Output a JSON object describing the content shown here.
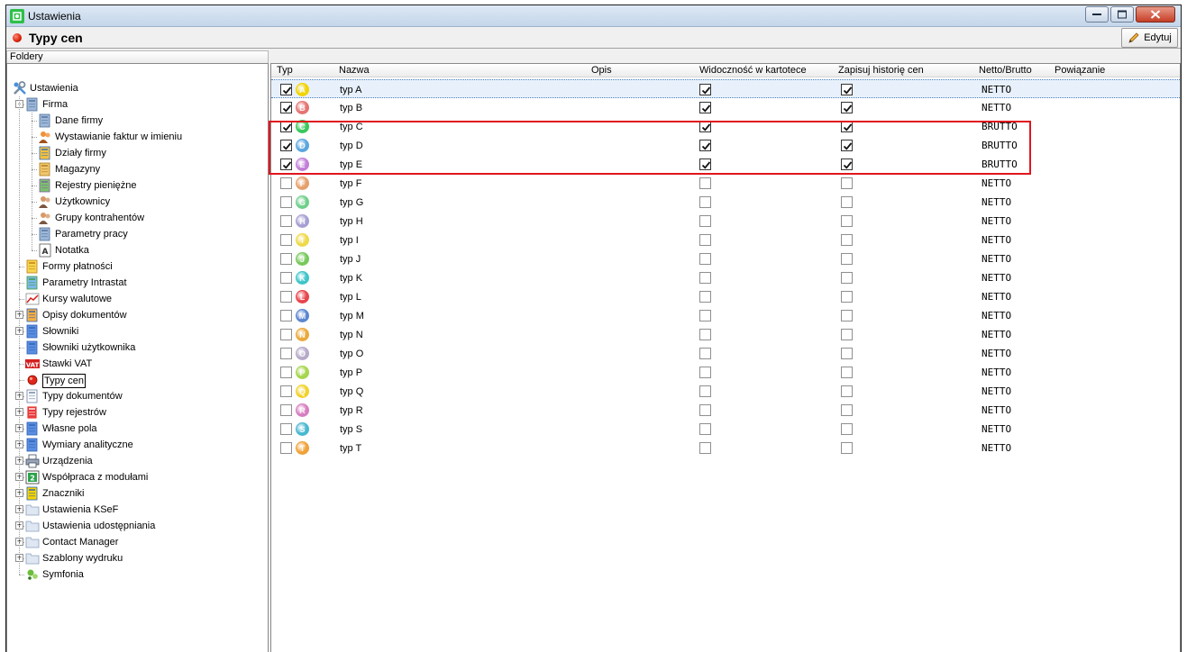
{
  "window": {
    "title": "Ustawienia"
  },
  "header": {
    "title": "Typy cen",
    "edit_label": "Edytuj"
  },
  "tree": {
    "header": "Foldery",
    "items": [
      {
        "label": "Ustawienia",
        "level": 0,
        "icon": "settings-tools-icon",
        "expander": null
      },
      {
        "label": "Firma",
        "level": 1,
        "icon": "company-icon",
        "expander": "-"
      },
      {
        "label": "Dane firmy",
        "level": 2,
        "icon": "company-data-icon",
        "expander": null
      },
      {
        "label": "Wystawianie faktur w imieniu",
        "level": 2,
        "icon": "person-icon",
        "expander": null
      },
      {
        "label": "Działy firmy",
        "level": 2,
        "icon": "departments-icon",
        "expander": null
      },
      {
        "label": "Magazyny",
        "level": 2,
        "icon": "warehouse-icon",
        "expander": null
      },
      {
        "label": "Rejestry pieniężne",
        "level": 2,
        "icon": "money-registers-icon",
        "expander": null
      },
      {
        "label": "Użytkownicy",
        "level": 2,
        "icon": "users-icon",
        "expander": null
      },
      {
        "label": "Grupy kontrahentów",
        "level": 2,
        "icon": "contractor-groups-icon",
        "expander": null
      },
      {
        "label": "Parametry pracy",
        "level": 2,
        "icon": "work-params-icon",
        "expander": null
      },
      {
        "label": "Notatka",
        "level": 2,
        "icon": "note-icon",
        "expander": null
      },
      {
        "label": "Formy płatności",
        "level": 1,
        "icon": "payment-forms-icon",
        "expander": null
      },
      {
        "label": "Parametry Intrastat",
        "level": 1,
        "icon": "intrastat-icon",
        "expander": null
      },
      {
        "label": "Kursy walutowe",
        "level": 1,
        "icon": "exchange-rates-icon",
        "expander": null
      },
      {
        "label": "Opisy dokumentów",
        "level": 1,
        "icon": "document-descriptions-icon",
        "expander": "+"
      },
      {
        "label": "Słowniki",
        "level": 1,
        "icon": "dictionaries-icon",
        "expander": "+"
      },
      {
        "label": "Słowniki użytkownika",
        "level": 1,
        "icon": "user-dictionaries-icon",
        "expander": null
      },
      {
        "label": "Stawki VAT",
        "level": 1,
        "icon": "vat-icon",
        "expander": null
      },
      {
        "label": "Typy cen",
        "level": 1,
        "icon": "red-dot-icon",
        "expander": null,
        "selected": true
      },
      {
        "label": "Typy dokumentów",
        "level": 1,
        "icon": "document-types-icon",
        "expander": "+"
      },
      {
        "label": "Typy rejestrów",
        "level": 1,
        "icon": "register-types-icon",
        "expander": "+"
      },
      {
        "label": "Własne pola",
        "level": 1,
        "icon": "custom-fields-icon",
        "expander": "+"
      },
      {
        "label": "Wymiary analityczne",
        "level": 1,
        "icon": "analytic-dimensions-icon",
        "expander": "+"
      },
      {
        "label": "Urządzenia",
        "level": 1,
        "icon": "printer-icon",
        "expander": "+"
      },
      {
        "label": "Współpraca z modułami",
        "level": 1,
        "icon": "modules-icon",
        "expander": "+"
      },
      {
        "label": "Znaczniki",
        "level": 1,
        "icon": "tags-icon",
        "expander": "+"
      },
      {
        "label": "Ustawienia KSeF",
        "level": 1,
        "icon": "folder-icon",
        "expander": "+"
      },
      {
        "label": "Ustawienia udostępniania",
        "level": 1,
        "icon": "folder-icon",
        "expander": "+"
      },
      {
        "label": "Contact Manager",
        "level": 1,
        "icon": "folder-icon",
        "expander": "+"
      },
      {
        "label": "Szablony wydruku",
        "level": 1,
        "icon": "folder-icon",
        "expander": "+"
      },
      {
        "label": "Symfonia",
        "level": 1,
        "icon": "symfonia-icon",
        "expander": null
      }
    ]
  },
  "grid": {
    "columns": {
      "typ": "Typ",
      "nazwa": "Nazwa",
      "opis": "Opis",
      "widocznosc": "Widoczność w kartotece",
      "historia": "Zapisuj historię cen",
      "netto_brutto": "Netto/Brutto",
      "powiazanie": "Powiązanie"
    },
    "rows": [
      {
        "letter": "A",
        "name": "typ A",
        "active": true,
        "visible": true,
        "history": true,
        "nb": "NETTO",
        "color": "#f2d300"
      },
      {
        "letter": "B",
        "name": "typ B",
        "active": true,
        "visible": true,
        "history": true,
        "nb": "NETTO",
        "color": "#e57373"
      },
      {
        "letter": "C",
        "name": "typ C",
        "active": true,
        "visible": true,
        "history": true,
        "nb": "BRUTTO",
        "color": "#37c85a"
      },
      {
        "letter": "D",
        "name": "typ D",
        "active": true,
        "visible": true,
        "history": true,
        "nb": "BRUTTO",
        "color": "#5aa6de"
      },
      {
        "letter": "E",
        "name": "typ E",
        "active": true,
        "visible": true,
        "history": true,
        "nb": "BRUTTO",
        "color": "#c27fd8"
      },
      {
        "letter": "F",
        "name": "typ F",
        "active": false,
        "visible": false,
        "history": false,
        "nb": "NETTO",
        "color": "#e6a06d"
      },
      {
        "letter": "G",
        "name": "typ G",
        "active": false,
        "visible": false,
        "history": false,
        "nb": "NETTO",
        "color": "#6fcf8b"
      },
      {
        "letter": "H",
        "name": "typ H",
        "active": false,
        "visible": false,
        "history": false,
        "nb": "NETTO",
        "color": "#a59fd3"
      },
      {
        "letter": "I",
        "name": "typ I",
        "active": false,
        "visible": false,
        "history": false,
        "nb": "NETTO",
        "color": "#efd94a"
      },
      {
        "letter": "J",
        "name": "typ J",
        "active": false,
        "visible": false,
        "history": false,
        "nb": "NETTO",
        "color": "#77c95c"
      },
      {
        "letter": "K",
        "name": "typ K",
        "active": false,
        "visible": false,
        "history": false,
        "nb": "NETTO",
        "color": "#3ec5c9"
      },
      {
        "letter": "L",
        "name": "typ L",
        "active": false,
        "visible": false,
        "history": false,
        "nb": "NETTO",
        "color": "#e8454b"
      },
      {
        "letter": "M",
        "name": "typ M",
        "active": false,
        "visible": false,
        "history": false,
        "nb": "NETTO",
        "color": "#5c86cf"
      },
      {
        "letter": "N",
        "name": "typ N",
        "active": false,
        "visible": false,
        "history": false,
        "nb": "NETTO",
        "color": "#eaa93c"
      },
      {
        "letter": "O",
        "name": "typ O",
        "active": false,
        "visible": false,
        "history": false,
        "nb": "NETTO",
        "color": "#b6a9c9"
      },
      {
        "letter": "P",
        "name": "typ P",
        "active": false,
        "visible": false,
        "history": false,
        "nb": "NETTO",
        "color": "#a6d64c"
      },
      {
        "letter": "Q",
        "name": "typ Q",
        "active": false,
        "visible": false,
        "history": false,
        "nb": "NETTO",
        "color": "#f0d22a"
      },
      {
        "letter": "R",
        "name": "typ R",
        "active": false,
        "visible": false,
        "history": false,
        "nb": "NETTO",
        "color": "#d67fc0"
      },
      {
        "letter": "S",
        "name": "typ S",
        "active": false,
        "visible": false,
        "history": false,
        "nb": "NETTO",
        "color": "#48b8d0"
      },
      {
        "letter": "T",
        "name": "typ T",
        "active": false,
        "visible": false,
        "history": false,
        "nb": "NETTO",
        "color": "#f0a23a"
      }
    ]
  }
}
